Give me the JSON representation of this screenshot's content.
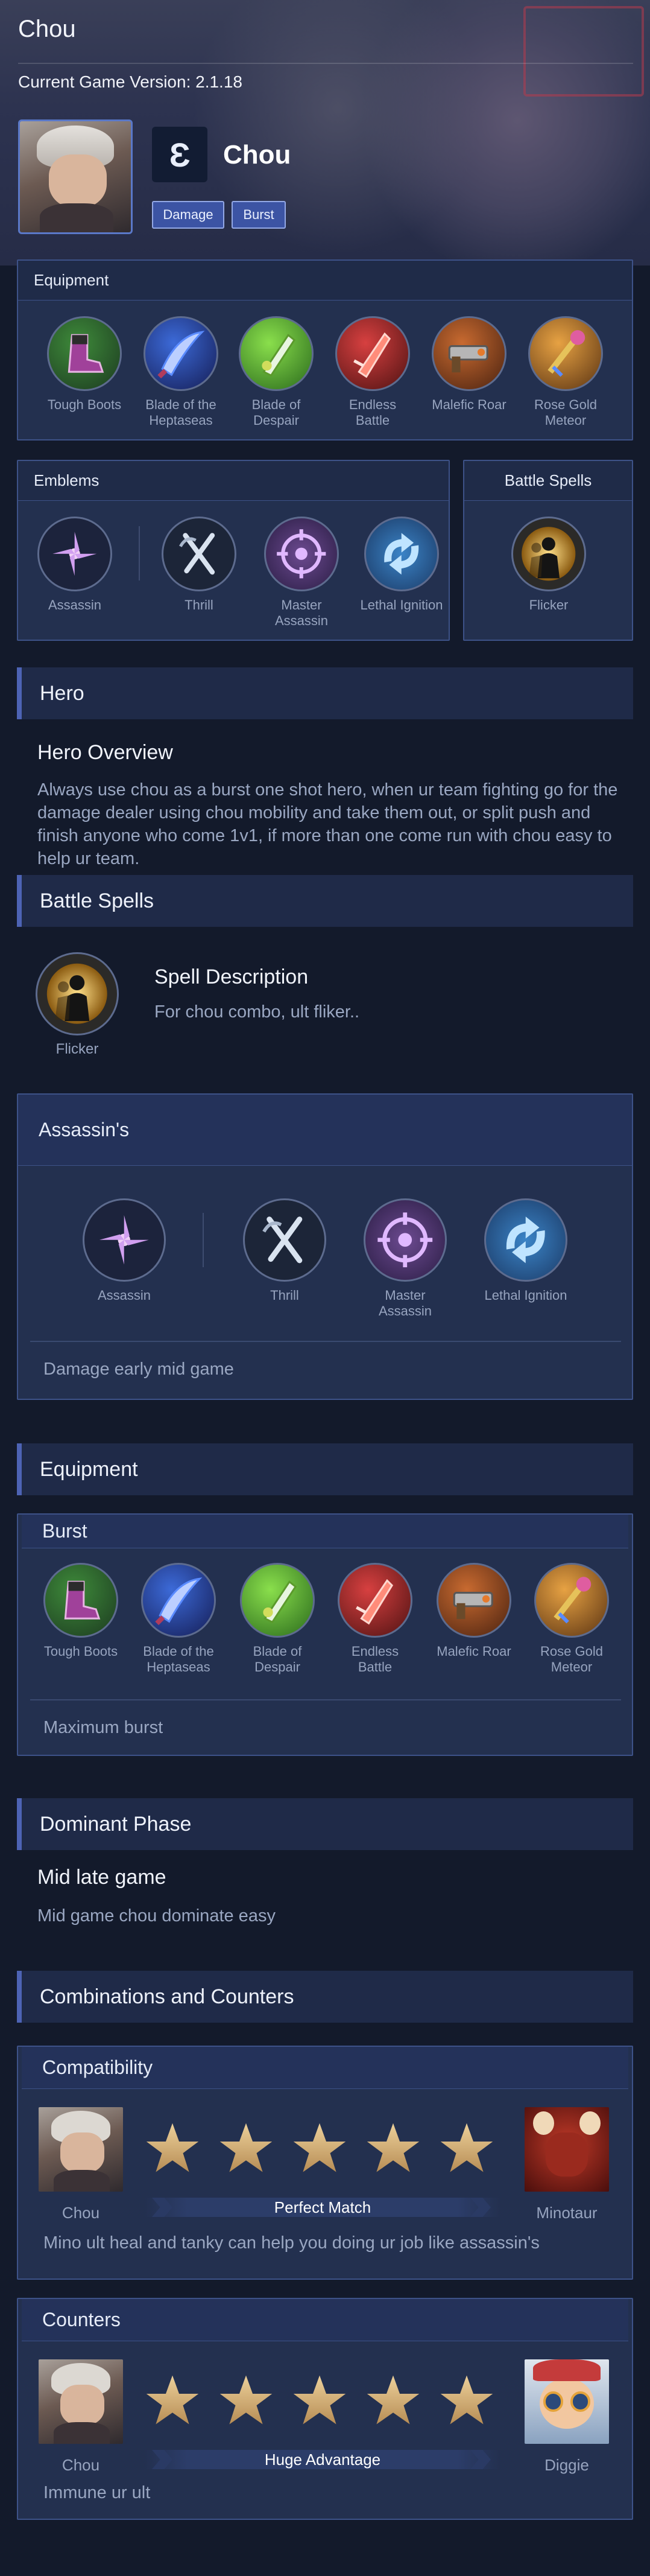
{
  "page": {
    "title": "Chou",
    "version_label": "Current Game Version: 2.1.18"
  },
  "hero": {
    "name": "Chou",
    "icon_glyph": "Ɛ",
    "tags": [
      "Damage",
      "Burst"
    ]
  },
  "top_equipment": {
    "header": "Equipment",
    "items": [
      "Tough Boots",
      "Blade of the Heptaseas",
      "Blade of Despair",
      "Endless Battle",
      "Malefic Roar",
      "Rose Gold Meteor"
    ]
  },
  "top_emblems": {
    "header": "Emblems",
    "items": [
      "Assassin",
      "Thrill",
      "Master Assassin",
      "Lethal Ignition"
    ]
  },
  "top_spells": {
    "header": "Battle Spells",
    "items": [
      "Flicker"
    ]
  },
  "hero_section": {
    "bar": "Hero",
    "overview_title": "Hero Overview",
    "overview_text": "Always use chou as a burst one shot hero, when ur team fighting go for the damage dealer using chou mobility and take them out, or split push and finish anyone who come 1v1, if more than one come run with chou easy to help ur team."
  },
  "spells_section": {
    "bar": "Battle Spells",
    "spell": "Flicker",
    "desc_title": "Spell Description",
    "desc_text": "For chou combo, ult fliker.."
  },
  "emblem_section": {
    "header": "Assassin's",
    "items": [
      "Assassin",
      "Thrill",
      "Master Assassin",
      "Lethal Ignition"
    ],
    "note": "Damage early mid game"
  },
  "equipment_section": {
    "bar": "Equipment",
    "build_name": "Burst",
    "items": [
      "Tough Boots",
      "Blade of the Heptaseas",
      "Blade of Despair",
      "Endless Battle",
      "Malefic Roar",
      "Rose Gold Meteor"
    ],
    "note": "Maximum burst"
  },
  "dominant_section": {
    "bar": "Dominant Phase",
    "title": "Mid late game",
    "text": "Mid game chou dominate easy"
  },
  "combos_section": {
    "bar": "Combinations and Counters",
    "compat": {
      "header": "Compatibility",
      "left": "Chou",
      "right": "Minotaur",
      "rating_stars": 5,
      "rating_label": "Perfect Match",
      "text": "Mino ult heal and tanky can help you doing ur job like assassin's"
    },
    "counters": {
      "header": "Counters",
      "left": "Chou",
      "right": "Diggie",
      "rating_stars": 5,
      "rating_label": "Huge Advantage",
      "text": "Immune ur ult"
    }
  },
  "colors": {
    "background": "#131a2b",
    "panel": "#23304f",
    "accent": "#4d63b4",
    "tag": "#3c54a4",
    "star": "#d4b078"
  },
  "icons": {
    "items": [
      "boots-icon",
      "sword-icon",
      "blade-icon",
      "crimson-blade-icon",
      "gun-icon",
      "meteor-icon"
    ],
    "emblems": [
      "shuriken-icon",
      "thrill-icon",
      "target-icon",
      "ignition-icon"
    ],
    "spell": "flicker-icon"
  }
}
